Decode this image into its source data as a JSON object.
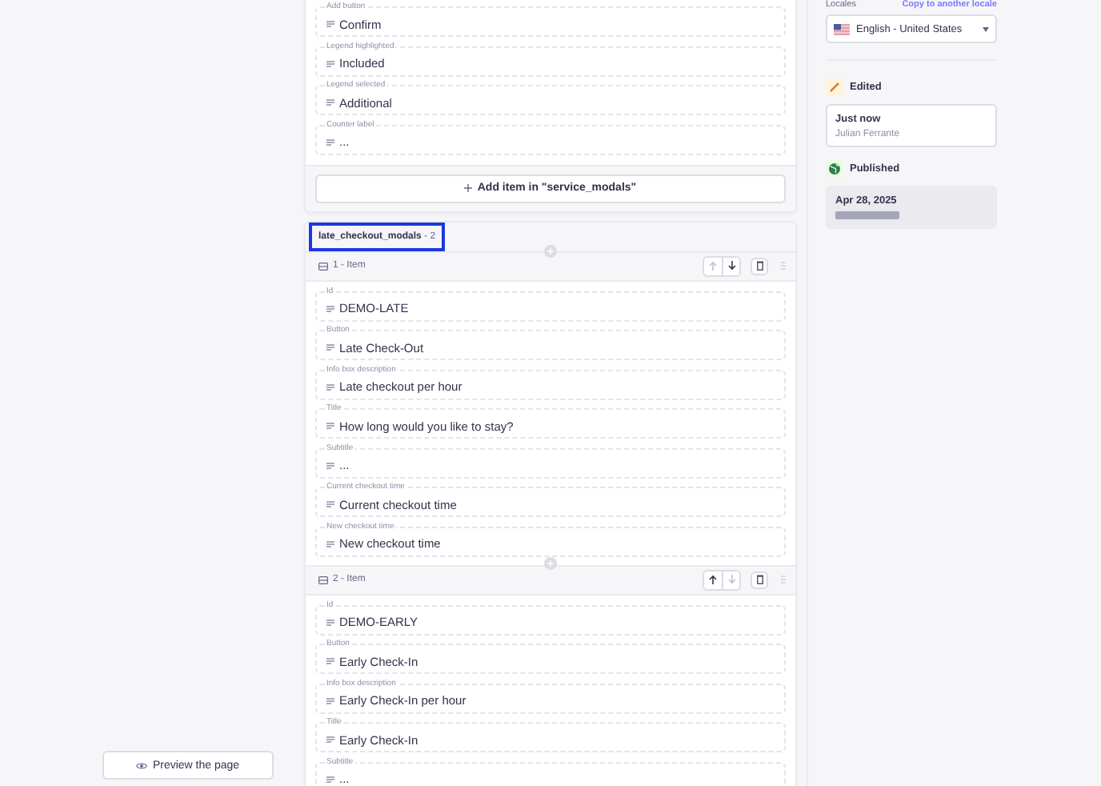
{
  "service_modals": {
    "fields": [
      {
        "label": "Add button",
        "value": "Confirm"
      },
      {
        "label": "Legend highlighted",
        "value": "Included"
      },
      {
        "label": "Legend selected",
        "value": "Additional"
      },
      {
        "label": "Counter label",
        "value": "..."
      }
    ],
    "add_button": "Add item in \"service_modals\""
  },
  "late_checkout_modals": {
    "name": "late_checkout_modals",
    "count": "- 2",
    "highlighted": true,
    "items": [
      {
        "title": "1 - Item",
        "can_move_up": false,
        "can_move_down": true,
        "fields": [
          {
            "label": "Id",
            "value": "DEMO-LATE"
          },
          {
            "label": "Button",
            "value": "Late Check-Out"
          },
          {
            "label": "Info box description",
            "value": "Late checkout per hour"
          },
          {
            "label": "Title",
            "value": "How long would you like to stay?"
          },
          {
            "label": "Subtitle",
            "value": "..."
          },
          {
            "label": "Current checkout time",
            "value": "Current checkout time"
          },
          {
            "label": "New checkout time",
            "value": "New checkout time"
          }
        ]
      },
      {
        "title": "2 - Item",
        "can_move_up": true,
        "can_move_down": false,
        "fields": [
          {
            "label": "Id",
            "value": "DEMO-EARLY"
          },
          {
            "label": "Button",
            "value": "Early Check-In"
          },
          {
            "label": "Info box description",
            "value": "Early Check-In per hour"
          },
          {
            "label": "Title",
            "value": "Early Check-In"
          },
          {
            "label": "Subtitle",
            "value": "..."
          }
        ]
      }
    ]
  },
  "preview_button": "Preview the page",
  "locales": {
    "label": "Locales",
    "copy_link": "Copy to another locale",
    "selected": "English - United States"
  },
  "edited": {
    "title": "Edited",
    "time": "Just now",
    "author": "Julian Ferrante"
  },
  "published": {
    "title": "Published",
    "date": "Apr 28, 2025"
  }
}
